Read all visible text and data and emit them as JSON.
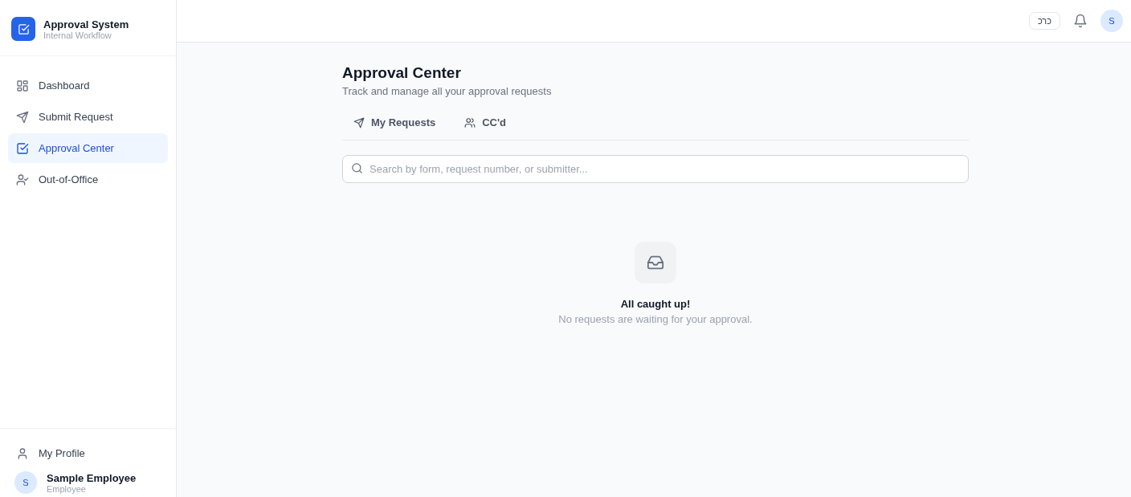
{
  "brand": {
    "title": "Approval System",
    "subtitle": "Internal Workflow"
  },
  "nav": [
    {
      "label": "Dashboard",
      "kind": "grid",
      "selected": false
    },
    {
      "label": "Submit Request",
      "kind": "send",
      "selected": false
    },
    {
      "label": "Approval Center",
      "kind": "check",
      "selected": true
    },
    {
      "label": "Out-of-Office",
      "kind": "absence",
      "selected": false
    }
  ],
  "profile_link": {
    "label": "My Profile"
  },
  "user": {
    "initial": "S",
    "name": "Sample Employee",
    "role": "Employee"
  },
  "topbar": {
    "language": "כרכ",
    "avatar": "S"
  },
  "page": {
    "title": "Approval Center",
    "subtitle": "Track and manage all your approval requests"
  },
  "tabs": [
    {
      "label": "My Requests",
      "kind": "sent",
      "selected": false
    },
    {
      "label": "CC'd",
      "kind": "copied",
      "selected": false
    }
  ],
  "search": {
    "placeholder": "Search by form, request number, or submitter..."
  },
  "empty": {
    "title": "All caught up!",
    "message": "No requests are waiting for your approval."
  }
}
